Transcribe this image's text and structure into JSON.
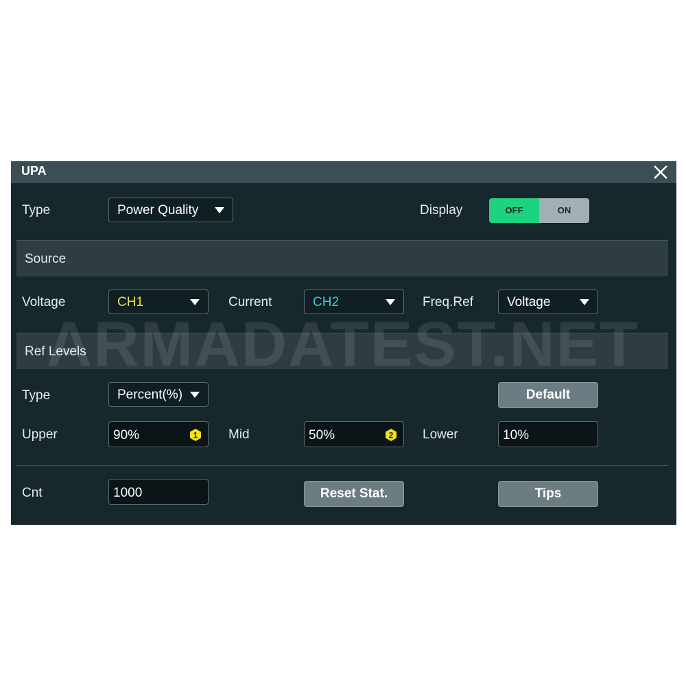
{
  "dialog": {
    "title": "UPA"
  },
  "type_row": {
    "label": "Type",
    "value": "Power Quality",
    "display_label": "Display",
    "toggle_off": "OFF",
    "toggle_on": "ON",
    "toggle_state": "OFF"
  },
  "source": {
    "header": "Source",
    "voltage_label": "Voltage",
    "voltage_value": "CH1",
    "current_label": "Current",
    "current_value": "CH2",
    "freqref_label": "Freq.Ref",
    "freqref_value": "Voltage"
  },
  "ref_levels": {
    "header": "Ref Levels",
    "type_label": "Type",
    "type_value": "Percent(%)",
    "default_button": "Default",
    "upper_label": "Upper",
    "upper_value": "90%",
    "upper_badge": "1",
    "mid_label": "Mid",
    "mid_value": "50%",
    "mid_badge": "2",
    "lower_label": "Lower",
    "lower_value": "10%"
  },
  "stats": {
    "cnt_label": "Cnt",
    "cnt_value": "1000",
    "reset_button": "Reset Stat.",
    "tips_button": "Tips"
  },
  "watermark": "ARMADATEST.NET",
  "colors": {
    "toggle_active": "#1ed37f",
    "toggle_inactive": "#a3b0b3",
    "ch1": "#e8e04a",
    "ch2": "#35d0d6",
    "badge": "#f2e21a"
  }
}
